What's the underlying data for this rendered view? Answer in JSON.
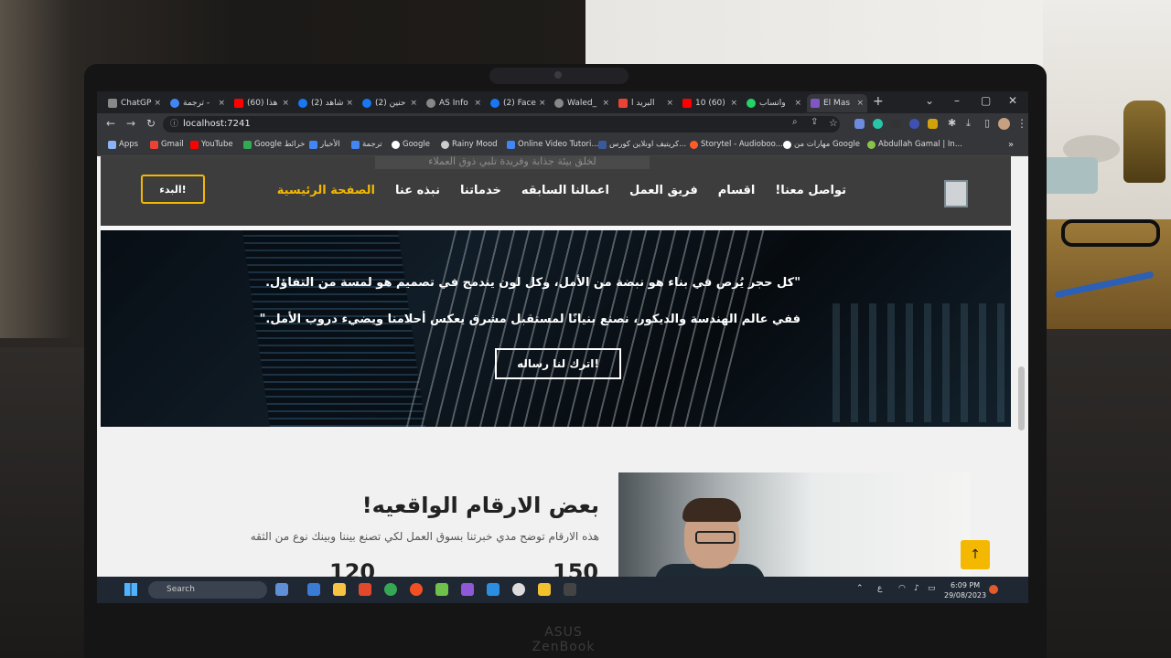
{
  "browser": {
    "tabs": [
      {
        "label": "ChatGP",
        "color": "#888888"
      },
      {
        "label": "ترجمة -",
        "color": "#4285f4"
      },
      {
        "label": "(60) هذا",
        "color": "#ff0000"
      },
      {
        "label": "(2) شاهد",
        "color": "#1877f2"
      },
      {
        "label": "(2) حنين",
        "color": "#1877f2"
      },
      {
        "label": "AS Info",
        "color": "#888888"
      },
      {
        "label": "(2) Face",
        "color": "#1877f2"
      },
      {
        "label": "Waled_",
        "color": "#888888"
      },
      {
        "label": "البريد ا",
        "color": "#ea4335"
      },
      {
        "label": "10 (60)",
        "color": "#ff0000"
      },
      {
        "label": "واتساب",
        "color": "#25d366"
      },
      {
        "label": "El Mas",
        "color": "#7e57c2"
      }
    ],
    "new_tab": "+",
    "url": "localhost:7241",
    "bookmarks": [
      {
        "label": "Apps",
        "color": "#8ab4f8"
      },
      {
        "label": "Gmail",
        "color": "#ea4335"
      },
      {
        "label": "YouTube",
        "color": "#ff0000"
      },
      {
        "label": "Google خرائط",
        "color": "#34a853"
      },
      {
        "label": "الأخبار",
        "color": "#4285f4"
      },
      {
        "label": "ترجمة",
        "color": "#4285f4"
      },
      {
        "label": "Google",
        "color": "#ffffff"
      },
      {
        "label": "Rainy Mood",
        "color": "#cccccc"
      },
      {
        "label": "Online Video Tutori...",
        "color": "#4285f4"
      },
      {
        "label": "كريتيف اونلاين كورس...",
        "color": "#3b5998"
      },
      {
        "label": "Storytel - Audioboo...",
        "color": "#ff5c28"
      },
      {
        "label": "مهارات من Google",
        "color": "#ffffff"
      },
      {
        "label": "Abdullah Gamal | In...",
        "color": "#8bc34a"
      }
    ]
  },
  "site": {
    "header_peek": "لخلق بيئة جذابة وفريدة تلبي ذوق العملاء",
    "nav": [
      {
        "label": "الصفحة الرئيسية",
        "active": true
      },
      {
        "label": "نبذه عنا",
        "active": false
      },
      {
        "label": "خدماتنا",
        "active": false
      },
      {
        "label": "اعمالنا السابقه",
        "active": false
      },
      {
        "label": "فريق العمل",
        "active": false
      },
      {
        "label": "اقسام",
        "active": false
      },
      {
        "label": "تواصل معنا!",
        "active": false
      }
    ],
    "start_button": "البدء!",
    "hero_line1": "\"كل حجر يُرص في بناء هو نبضة من الأمل، وكل لون يندمج في تصميم هو لمسة من التفاؤل.",
    "hero_line2": "ففي عالم الهندسة والديكور، نصنع بنيانًا لمستقبل مشرق يعكس أحلامنا ويضيء دروب الأمل.\"",
    "hero_button": "اترك لنا رساله!",
    "stats_title": "بعض الارقام الواقعيه!",
    "stats_subtitle": "هذه الارقام توضح مدي خبرتنا بسوق العمل لكي تصنع بيننا وبينك نوع من الثقه",
    "stat_a": "150",
    "stat_b": "120",
    "scroll_top": "↑",
    "accent": "#f5b800"
  },
  "taskbar": {
    "search": "Search",
    "lang": "ع",
    "time": "6:09 PM",
    "date": "29/08/2023"
  },
  "laptop_brand": "ASUS ZenBook"
}
